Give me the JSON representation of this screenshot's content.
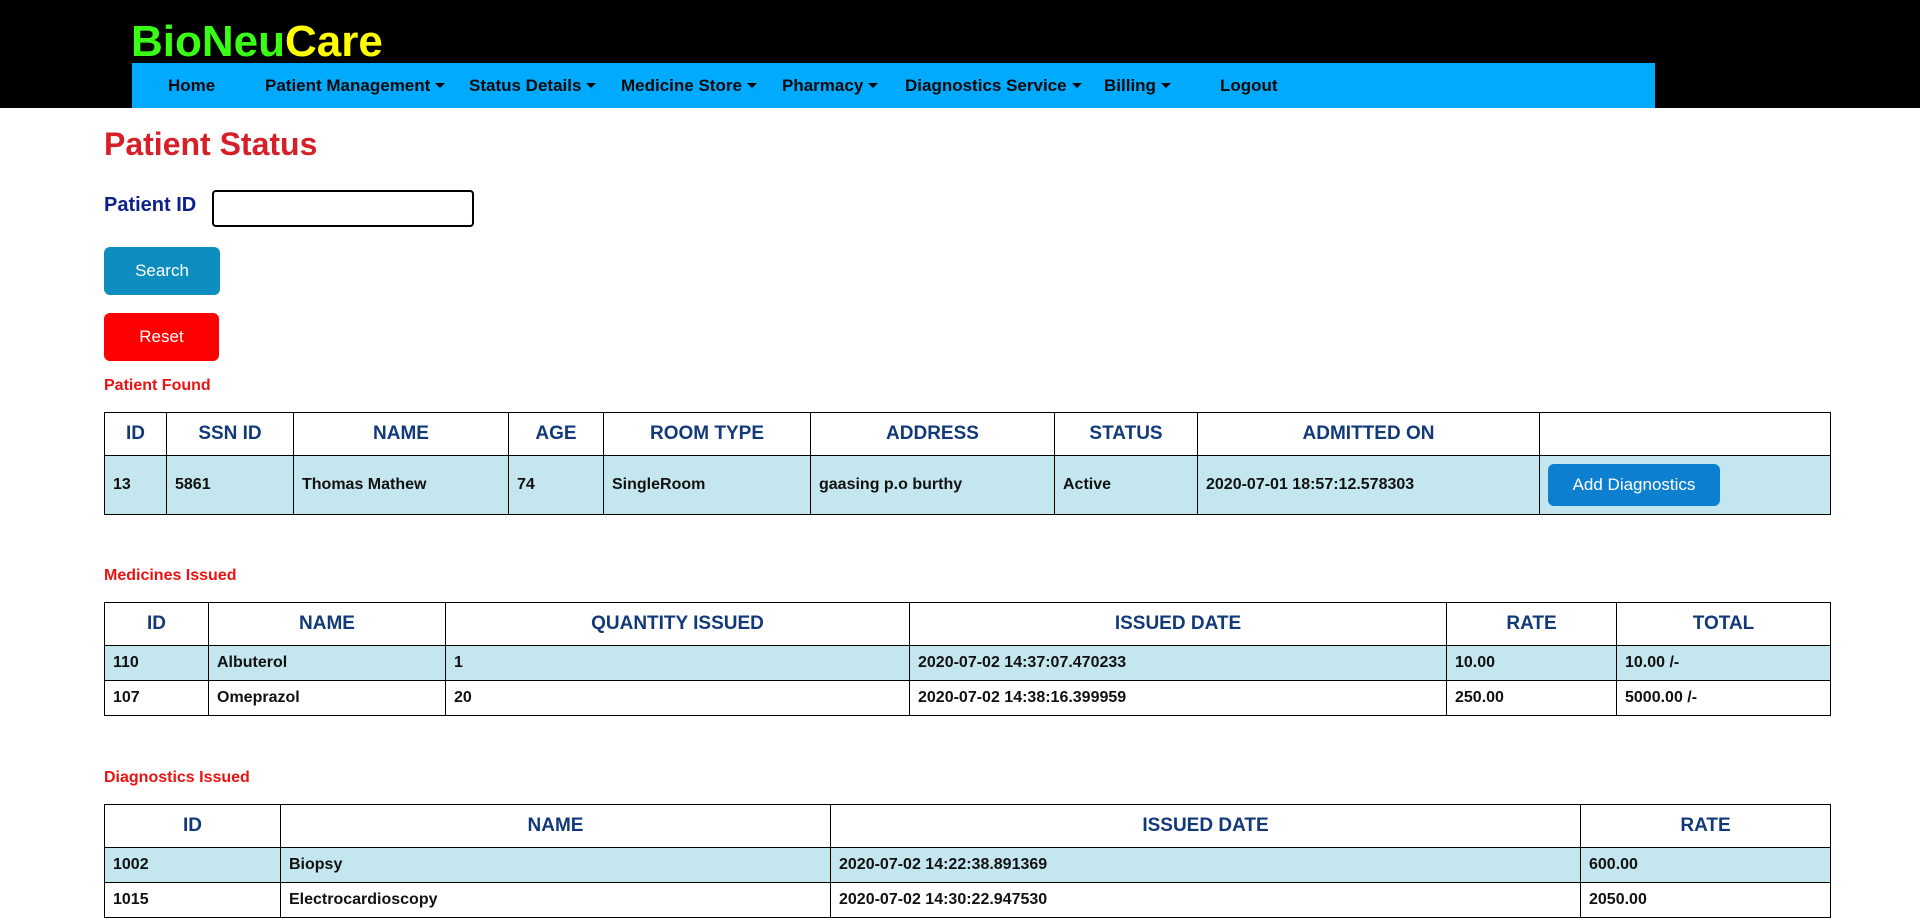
{
  "brand": {
    "part1": "BioNeu",
    "part2": "Care"
  },
  "nav": [
    {
      "label": "Home",
      "dropdown": false
    },
    {
      "label": "Patient Management",
      "dropdown": true
    },
    {
      "label": "Status Details",
      "dropdown": true
    },
    {
      "label": "Medicine Store",
      "dropdown": true
    },
    {
      "label": "Pharmacy",
      "dropdown": true
    },
    {
      "label": "Diagnostics Service",
      "dropdown": true
    },
    {
      "label": "Billing",
      "dropdown": true
    },
    {
      "label": "Logout",
      "dropdown": false
    }
  ],
  "page": {
    "title": "Patient Status",
    "patient_id_label": "Patient ID",
    "patient_id_value": "",
    "search_label": "Search",
    "reset_label": "Reset"
  },
  "patient": {
    "section_label": "Patient Found",
    "headers": [
      "ID",
      "SSN ID",
      "NAME",
      "AGE",
      "ROOM TYPE",
      "ADDRESS",
      "STATUS",
      "ADMITTED ON",
      ""
    ],
    "row": [
      "13",
      "5861",
      "Thomas Mathew",
      "74",
      "SingleRoom",
      "gaasing p.o burthy",
      "Active",
      "2020-07-01 18:57:12.578303"
    ],
    "action_label": "Add Diagnostics"
  },
  "medicines": {
    "section_label": "Medicines Issued",
    "headers": [
      "ID",
      "NAME",
      "QUANTITY ISSUED",
      "ISSUED DATE",
      "RATE",
      "TOTAL"
    ],
    "rows": [
      [
        "110",
        "Albuterol",
        "1",
        "2020-07-02 14:37:07.470233",
        "10.00",
        "10.00 /-"
      ],
      [
        "107",
        "Omeprazol",
        "20",
        "2020-07-02 14:38:16.399959",
        "250.00",
        "5000.00 /-"
      ]
    ]
  },
  "diagnostics": {
    "section_label": "Diagnostics Issued",
    "headers": [
      "ID",
      "NAME",
      "ISSUED DATE",
      "RATE"
    ],
    "rows": [
      [
        "1002",
        "Biopsy",
        "2020-07-02 14:22:38.891369",
        "600.00"
      ],
      [
        "1015",
        "Electrocardioscopy",
        "2020-07-02 14:30:22.947530",
        "2050.00"
      ]
    ]
  },
  "colors": {
    "header_bg": "#000000",
    "nav_bg": "#00aaff",
    "title": "#d61f26",
    "row_shade": "#c4e6ee",
    "search_button": "#0e8ebf",
    "reset_button": "#ff0000",
    "action_button": "#0d7fd0"
  }
}
